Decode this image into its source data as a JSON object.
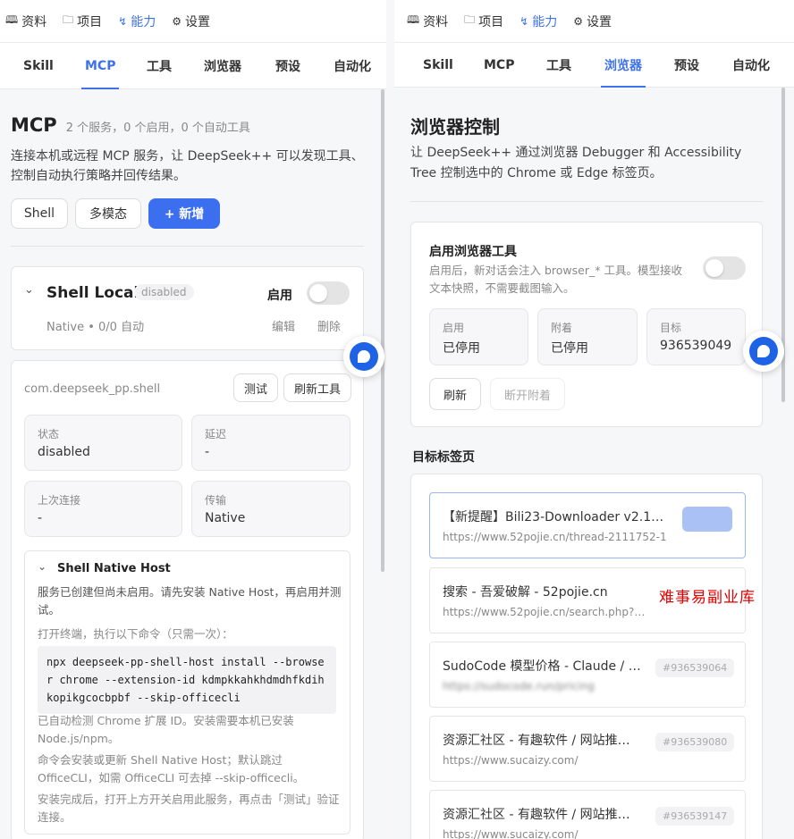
{
  "colors": {
    "accent": "#3e72e8",
    "primary_button": "#3b6ff0",
    "watermark": "#e00000"
  },
  "topnav": [
    {
      "icon": "book-icon",
      "glyph": "🕮",
      "label": "资料"
    },
    {
      "icon": "folder-icon",
      "glyph": "□",
      "label": "项目"
    },
    {
      "icon": "lightning-icon",
      "glyph": "ϟ",
      "label": "能力"
    },
    {
      "icon": "gear-icon",
      "glyph": "⚙",
      "label": "设置"
    }
  ],
  "subtabs": [
    "Skill",
    "MCP",
    "工具",
    "浏览器",
    "预设",
    "自动化"
  ],
  "left": {
    "active_tab": "MCP",
    "heading": "MCP",
    "heading_meta": "2 个服务，0 个启用，0 个自动工具",
    "description": "连接本机或远程 MCP 服务，让 DeepSeek++ 可以发现工具、控制自动执行策略并回传结果。",
    "preset_chips": [
      "Shell",
      "多模态"
    ],
    "add_button": "+ 新增",
    "server": {
      "name": "Shell Local",
      "status_badge": "disabled",
      "enable_label": "启用",
      "meta": "Native • 0/0 自动",
      "edit": "编辑",
      "delete": "删除"
    },
    "detail": {
      "id": "com.deepseek_pp.shell",
      "test_button": "测试",
      "refresh_button": "刷新工具",
      "stats": [
        {
          "label": "状态",
          "value": "disabled"
        },
        {
          "label": "延迟",
          "value": "-"
        },
        {
          "label": "上次连接",
          "value": "-"
        },
        {
          "label": "传输",
          "value": "Native"
        }
      ],
      "host": {
        "title": "Shell Native Host",
        "desc": "服务已创建但尚未启用。请先安装 Native Host，再启用并测试。",
        "cmd_intro": "打开终端，执行以下命令（只需一次）：",
        "command": "npx deepseek-pp-shell-host install --browser chrome --extension-id kdmpkkahkhdmdhfkdihkopikgcocbpbf --skip-officecli",
        "note1": "已自动检测 Chrome 扩展 ID。安装需要本机已安装 Node.js/npm。",
        "note2": "命令会安装或更新 Shell Native Host；默认跳过 OfficeCLI，如需 OfficeCLI 可去掉 --skip-officecli。",
        "note3": "安装完成后，打开上方开关启用此服务，再点击「测试」验证连接。"
      }
    }
  },
  "right": {
    "active_tab": "浏览器",
    "heading": "浏览器控制",
    "description": "让 DeepSeek++ 通过浏览器 Debugger 和 Accessibility Tree 控制选中的 Chrome 或 Edge 标签页。",
    "tool_card": {
      "title": "启用浏览器工具",
      "desc": "启用后，新对话会注入 browser_* 工具。模型接收文本快照，不需要截图输入。",
      "stats": [
        {
          "label": "启用",
          "value": "已停用"
        },
        {
          "label": "附着",
          "value": "已停用"
        },
        {
          "label": "目标",
          "value": "936539049"
        }
      ],
      "refresh_button": "刷新",
      "detach_button": "断开附着"
    },
    "targets_heading": "目标标签页",
    "targets": [
      {
        "title": "【新提醒】Bili23-Downloader v2.1…",
        "url": "https://www.52pojie.cn/thread-2111752-1-…",
        "badge": "",
        "selected": true
      },
      {
        "title": "搜索 - 吾爱破解 - 52pojie.cn",
        "url": "https://www.52pojie.cn/search.php?…",
        "badge": "",
        "selected": false
      },
      {
        "title": "SudoCode 模型价格 - Claude / …",
        "url": "https://sudocode.run/pricing",
        "badge": "#936539064",
        "selected": false
      },
      {
        "title": "资源汇社区 - 有趣软件 / 网站推…",
        "url": "https://www.sucaizy.com/",
        "badge": "#936539080",
        "selected": false
      },
      {
        "title": "资源汇社区 - 有趣软件 / 网站推…",
        "url": "https://www.sucaizy.com/",
        "badge": "#936539147",
        "selected": false
      }
    ]
  },
  "watermark": "难事易副业库"
}
